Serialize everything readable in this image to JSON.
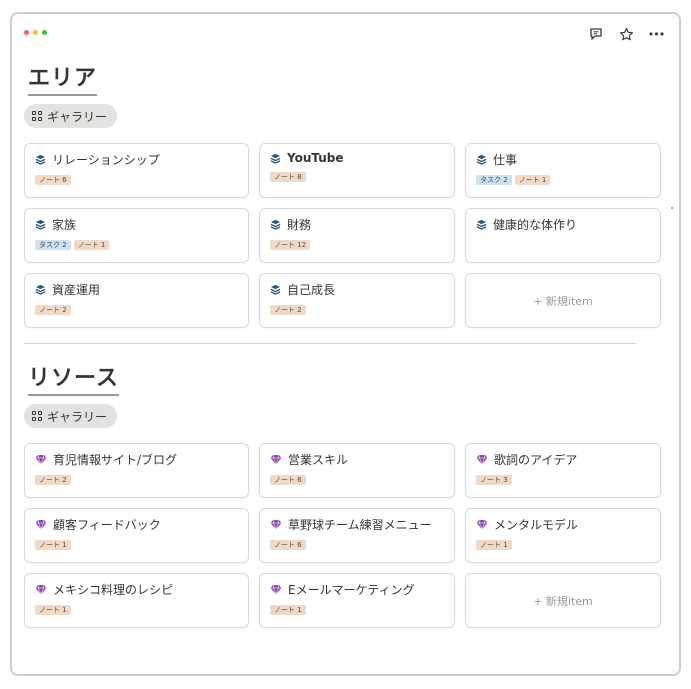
{
  "toolbar": {
    "icons": [
      "comment-icon",
      "star-icon",
      "more-icon"
    ],
    "more_label": "•••"
  },
  "areas": {
    "title": "エリア",
    "view_tab": "ギャラリー",
    "cards": [
      {
        "title": "リレーションシップ",
        "icon": "stack-icon",
        "tags": [
          {
            "type": "note",
            "label": "ノート 6"
          }
        ]
      },
      {
        "title": "YouTube",
        "icon": "stack-icon",
        "bold": true,
        "tags": [
          {
            "type": "note",
            "label": "ノート 8"
          }
        ]
      },
      {
        "title": "仕事",
        "icon": "stack-icon",
        "tags": [
          {
            "type": "task",
            "label": "タスク 2"
          },
          {
            "type": "note",
            "label": "ノート 1"
          }
        ]
      },
      {
        "title": "家族",
        "icon": "stack-icon",
        "tags": [
          {
            "type": "task",
            "label": "タスク 2"
          },
          {
            "type": "note",
            "label": "ノート 1"
          }
        ]
      },
      {
        "title": "財務",
        "icon": "stack-icon",
        "tags": [
          {
            "type": "note",
            "label": "ノート 12"
          }
        ]
      },
      {
        "title": "健康的な体作り",
        "icon": "stack-icon",
        "tags": []
      },
      {
        "title": "資産運用",
        "icon": "stack-icon",
        "tags": [
          {
            "type": "note",
            "label": "ノート 2"
          }
        ]
      },
      {
        "title": "自己成長",
        "icon": "stack-icon",
        "tags": [
          {
            "type": "note",
            "label": "ノート 2"
          }
        ]
      }
    ],
    "new_label": "+ 新規item"
  },
  "resources": {
    "title": "リソース",
    "view_tab": "ギャラリー",
    "cards": [
      {
        "title": "育児情報サイト/ブログ",
        "icon": "gem-icon",
        "tags": [
          {
            "type": "note",
            "label": "ノート 2"
          }
        ]
      },
      {
        "title": "営業スキル",
        "icon": "gem-icon",
        "tags": [
          {
            "type": "note",
            "label": "ノート 6"
          }
        ]
      },
      {
        "title": "歌詞のアイデア",
        "icon": "gem-icon",
        "tags": [
          {
            "type": "note",
            "label": "ノート 3"
          }
        ]
      },
      {
        "title": "顧客フィードバック",
        "icon": "gem-icon",
        "tags": [
          {
            "type": "note",
            "label": "ノート 1"
          }
        ]
      },
      {
        "title": "草野球チーム練習メニュー",
        "icon": "gem-icon",
        "tags": [
          {
            "type": "note",
            "label": "ノート 6"
          }
        ]
      },
      {
        "title": "メンタルモデル",
        "icon": "gem-icon",
        "tags": [
          {
            "type": "note",
            "label": "ノート 1"
          }
        ]
      },
      {
        "title": "メキシコ料理のレシピ",
        "icon": "gem-icon",
        "tags": [
          {
            "type": "note",
            "label": "ノート 1"
          }
        ]
      },
      {
        "title": "Eメールマーケティング",
        "icon": "gem-icon",
        "tags": [
          {
            "type": "note",
            "label": "ノート 1"
          }
        ]
      }
    ],
    "new_label": "+ 新規item"
  },
  "colors": {
    "stack_icon": "#2b5a7c",
    "gem_icon": "#8e3fa8",
    "note_tag_bg": "#f0d9c6",
    "task_tag_bg": "#cfe0ee"
  }
}
